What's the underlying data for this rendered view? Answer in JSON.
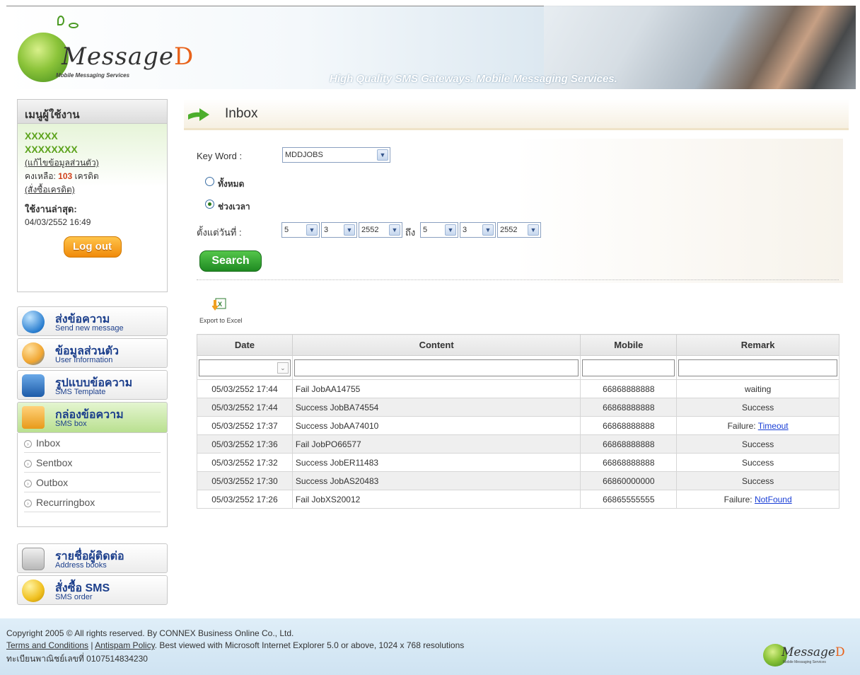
{
  "header": {
    "logo_text": "Message",
    "logo_suffix": "D",
    "logo_tagline": "Mobile Messaging Services",
    "tagline": "High Quality SMS Gateways. Mobile Messaging Services."
  },
  "user_panel": {
    "title": "เมนูผู้ใช้งาน",
    "username1": "XXXXX",
    "username2": "XXXXXXXX",
    "edit_profile": "(แก้ไขข้อมูลส่วนตัว)",
    "balance_label": "คงเหลือ:",
    "balance_value": "103",
    "balance_unit": "เครดิต",
    "buy_credit": "(สั่งซื้อเครดิต)",
    "last_used_label": "ใช้งานล่าสุด:",
    "last_used_value": "04/03/2552 16:49",
    "logout": "Log out"
  },
  "nav": {
    "send": {
      "label": "ส่งข้อความ",
      "sub": "Send new message"
    },
    "user_info": {
      "label": "ข้อมูลส่วนตัว",
      "sub": "User Information"
    },
    "template": {
      "label": "รูปแบบข้อความ",
      "sub": "SMS Template"
    },
    "smsbox": {
      "label": "กล่องข้อความ",
      "sub": "SMS box"
    },
    "submenu": [
      "Inbox",
      "Sentbox",
      "Outbox",
      "Recurringbox"
    ],
    "address": {
      "label": "รายชื่อผู้ติดต่อ",
      "sub": "Address books"
    },
    "order": {
      "label": "สั่งซื้อ SMS",
      "sub": "SMS order"
    }
  },
  "content": {
    "title": "Inbox",
    "keyword_label": "Key Word :",
    "keyword_value": "MDDJOBS",
    "radio_all": "ทั้งหมด",
    "radio_period": "ช่วงเวลา",
    "since_label": "ตั้งแต่วันที่ :",
    "to_label": "ถึง",
    "from_date": {
      "day": "5",
      "month": "3",
      "year": "2552"
    },
    "to_date": {
      "day": "5",
      "month": "3",
      "year": "2552"
    },
    "search_button": "Search",
    "export_label": "Export to Excel"
  },
  "table": {
    "headers": [
      "Date",
      "Content",
      "Mobile",
      "Remark"
    ],
    "rows": [
      {
        "date": "05/03/2552 17:44",
        "content": "Fail JobAA14755",
        "mobile": "66868888888",
        "remark": "waiting",
        "link": ""
      },
      {
        "date": "05/03/2552 17:44",
        "content": "Success JobBA74554",
        "mobile": "66868888888",
        "remark": "Success",
        "link": ""
      },
      {
        "date": "05/03/2552 17:37",
        "content": "Success JobAA74010",
        "mobile": "66868888888",
        "remark": "Failure: ",
        "link": "Timeout"
      },
      {
        "date": "05/03/2552 17:36",
        "content": "Fail JobPO66577",
        "mobile": "66868888888",
        "remark": "Success",
        "link": ""
      },
      {
        "date": "05/03/2552 17:32",
        "content": "Success JobER11483",
        "mobile": "66868888888",
        "remark": "Success",
        "link": ""
      },
      {
        "date": "05/03/2552 17:30",
        "content": "Success JobAS20483",
        "mobile": "66860000000",
        "remark": "Success",
        "link": ""
      },
      {
        "date": "05/03/2552 17:26",
        "content": "Fail JobXS20012",
        "mobile": "66865555555",
        "remark": "Failure: ",
        "link": "NotFound"
      }
    ]
  },
  "footer": {
    "copyright": "Copyright 2005 © All rights reserved. By CONNEX Business Online Co., Ltd.",
    "terms": "Terms and Conditions",
    "separator": "|",
    "antispam": "Antispam Policy",
    "browser_note": ". Best viewed with Microsoft Internet Explorer 5.0 or above, 1024 x 768 resolutions",
    "registration": "ทะเบียนพาณิชย์เลขที่ 0107514834230"
  }
}
